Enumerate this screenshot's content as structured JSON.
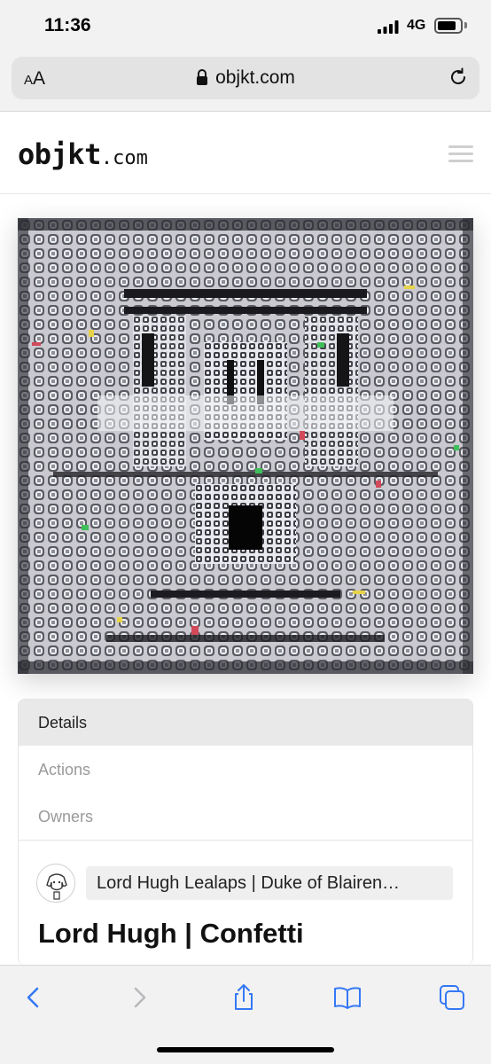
{
  "status_bar": {
    "time": "11:36",
    "network": "4G"
  },
  "browser": {
    "text_size_label": "AA",
    "url": "objkt.com",
    "icons": [
      "lock-icon",
      "reload-icon",
      "back-icon",
      "forward-icon",
      "share-icon",
      "bookmarks-icon",
      "tabs-icon"
    ]
  },
  "site": {
    "logo_main": "objkt",
    "logo_suffix": ".com"
  },
  "token": {
    "tabs": [
      "Details",
      "Actions",
      "Owners"
    ],
    "creator": "Lord Hugh Lealaps | Duke of Blairen…",
    "title": "Lord Hugh | Confetti"
  },
  "colors": {
    "accent": "#3478f6",
    "toolbar_bg": "#f2f2f2",
    "tab_active_bg": "#e9e9e9"
  }
}
